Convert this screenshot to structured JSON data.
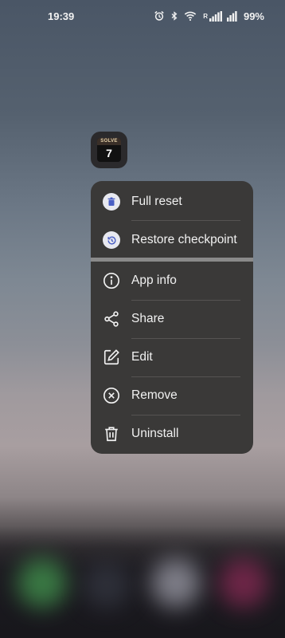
{
  "status_bar": {
    "time": "19:39",
    "signal_label": "R",
    "battery": "99%"
  },
  "app": {
    "icon_top_text": "SOLVE",
    "icon_number": "7"
  },
  "menu": {
    "shortcuts": [
      {
        "label": "Full reset",
        "icon": "trash-icon"
      },
      {
        "label": "Restore checkpoint",
        "icon": "history-icon"
      }
    ],
    "actions": [
      {
        "label": "App info",
        "icon": "info-icon"
      },
      {
        "label": "Share",
        "icon": "share-icon"
      },
      {
        "label": "Edit",
        "icon": "edit-icon"
      },
      {
        "label": "Remove",
        "icon": "close-circle-icon"
      },
      {
        "label": "Uninstall",
        "icon": "trash-icon"
      }
    ]
  },
  "colors": {
    "menu_bg": "#3a3938",
    "shortcut_icon_bg": "#e8e9f0",
    "shortcut_icon_fg": "#4a5fc4"
  }
}
